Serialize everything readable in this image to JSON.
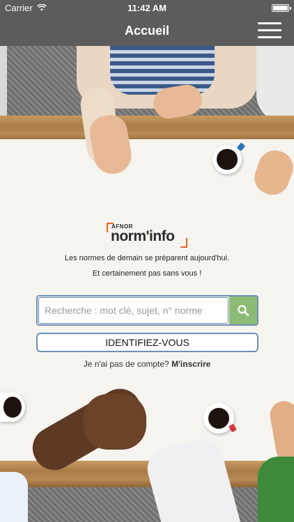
{
  "status_bar": {
    "carrier": "Carrier",
    "time": "11:42 AM",
    "battery_level": 1.0
  },
  "nav": {
    "title": "Accueil"
  },
  "logo": {
    "brand": "AFNOR",
    "product": "norm'info"
  },
  "tagline": {
    "line1": "Les normes de demain se préparent aujourd'hui.",
    "line2": "Et certainement pas sans vous !"
  },
  "search": {
    "placeholder": "Recherche : mot clé, sujet, n° norme",
    "value": ""
  },
  "login": {
    "label": "IDENTIFIEZ-VOUS"
  },
  "signup": {
    "prompt": "Je n'ai pas de compte?",
    "link": "M'inscrire"
  },
  "colors": {
    "nav_bg": "#5c5c5c",
    "accent_orange": "#e8621f",
    "search_green": "#8dbb75",
    "border_blue": "#6d8fb3"
  }
}
